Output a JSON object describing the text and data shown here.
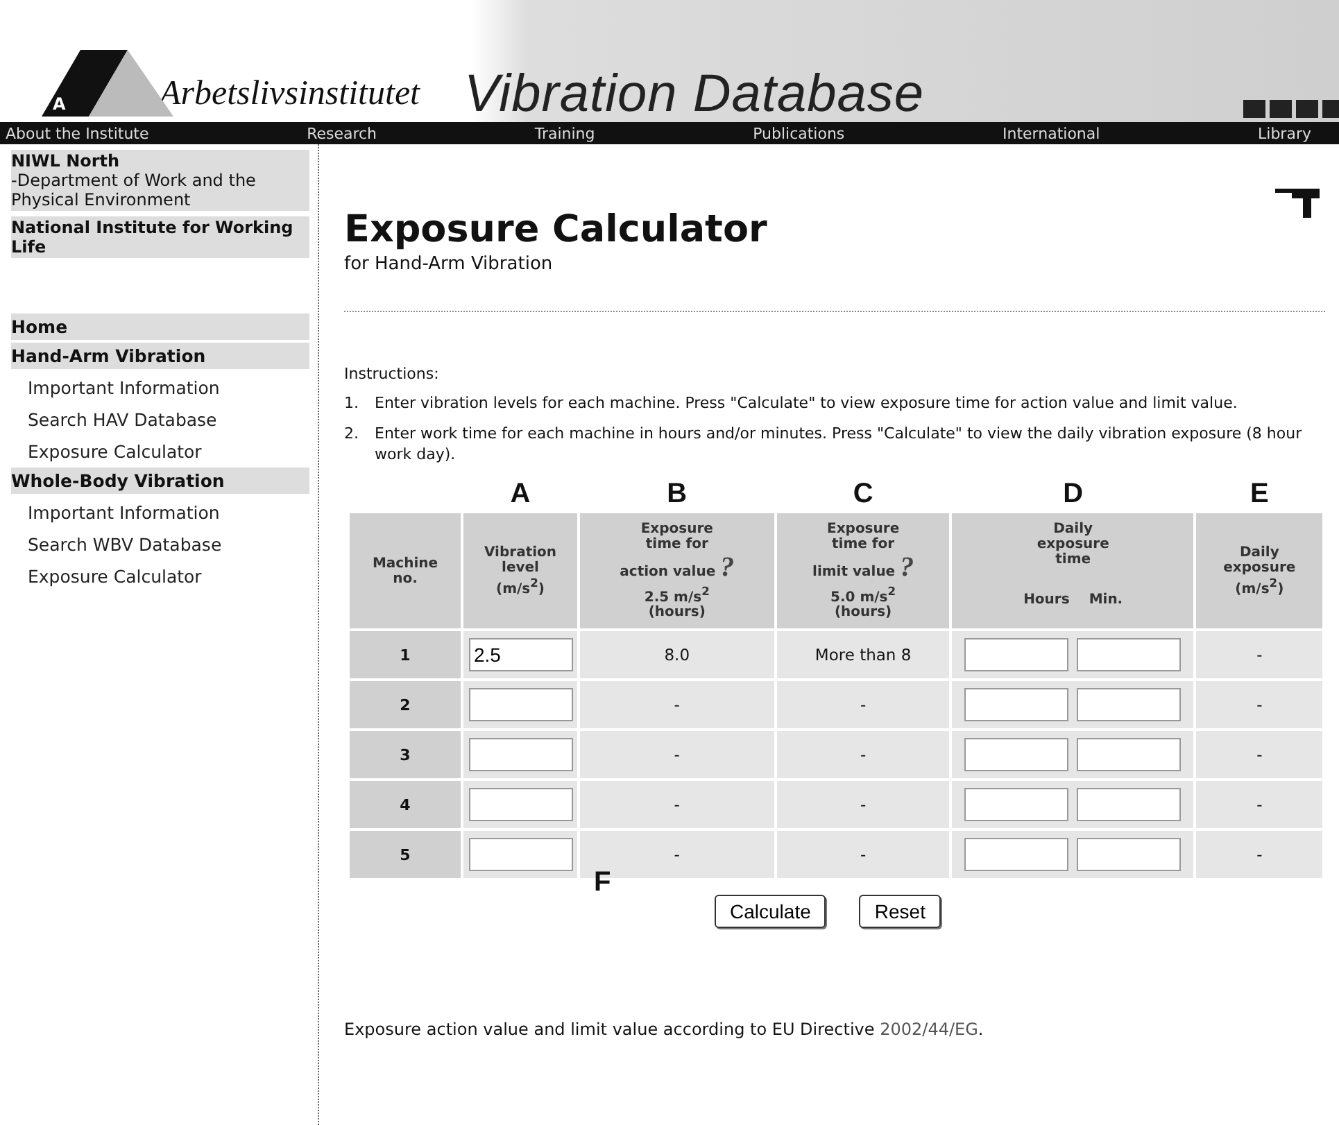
{
  "header": {
    "logo_letter": "A",
    "org_name": "Arbetslivsinstitutet",
    "site_title": "Vibration Database"
  },
  "nav": [
    "About the Institute",
    "Research",
    "Training",
    "Publications",
    "International",
    "Library"
  ],
  "sidebar": {
    "org": [
      {
        "kind": "heading",
        "text": "NIWL North"
      },
      {
        "kind": "text",
        "text": "-Department of Work and the Physical Environment"
      },
      {
        "kind": "heading",
        "text": "National Institute for Working Life"
      }
    ],
    "menu": [
      {
        "label": "Home"
      },
      {
        "label": "Hand-Arm Vibration",
        "children": [
          {
            "label": "Important Information"
          },
          {
            "label": "Search HAV Database"
          },
          {
            "label": "Exposure Calculator"
          }
        ]
      },
      {
        "label": "Whole-Body Vibration",
        "children": [
          {
            "label": "Important Information"
          },
          {
            "label": "Search WBV Database"
          },
          {
            "label": "Exposure Calculator"
          }
        ]
      }
    ]
  },
  "main": {
    "title": "Exposure Calculator",
    "subtitle": "for Hand-Arm Vibration",
    "instructions_label": "Instructions:",
    "instructions": [
      {
        "number": "1.",
        "text": "Enter vibration levels for each machine. Press \"Calculate\" to view exposure time for action value and limit value."
      },
      {
        "number": "2.",
        "text": "Enter work time for each machine in hours and/or minutes. Press \"Calculate\" to view the daily vibration exposure (8 hour work day)."
      }
    ],
    "column_letters": [
      "A",
      "B",
      "C",
      "D",
      "E"
    ],
    "columns": [
      {
        "lines": [
          "Machine",
          "no."
        ]
      },
      {
        "lines": [
          "Vibration",
          "level",
          "(m/s$^{2}$)"
        ]
      },
      {
        "lines": [
          "Exposure",
          "time for",
          "action value"
        ],
        "help": "?",
        "unit_lines": [
          "2.5 m/s$^{2}$",
          "(hours)"
        ]
      },
      {
        "lines": [
          "Exposure",
          "time for",
          "limit value"
        ],
        "help": "?",
        "unit_lines": [
          "5.0 m/s$^{2}$",
          "(hours)"
        ]
      },
      {
        "lines": [
          "Daily",
          "exposure",
          "time"
        ],
        "sub": [
          "Hours",
          "Min."
        ]
      },
      {
        "lines": [
          "Daily",
          "exposure",
          "(m/s$^{2}$)"
        ]
      }
    ],
    "rows": [
      {
        "no": "1",
        "level": "2.5",
        "action_time": "8.0",
        "limit_time": "More than 8",
        "daily_exposure": "-"
      },
      {
        "no": "2",
        "action_time": "-",
        "limit_time": "-",
        "daily_exposure": "-"
      },
      {
        "no": "3",
        "action_time": "-",
        "limit_time": "-",
        "daily_exposure": "-"
      },
      {
        "no": "4",
        "action_time": "-",
        "limit_time": "-",
        "daily_exposure": "-"
      },
      {
        "no": "5",
        "action_time": "-",
        "limit_time": "-",
        "daily_exposure": "-"
      }
    ],
    "bottom_letter": "F",
    "buttons": [
      "Calculate",
      "Reset"
    ],
    "note": {
      "text": "Exposure action value and limit value according to EU Directive",
      "link": "2002/44/EG",
      "end": "."
    }
  }
}
